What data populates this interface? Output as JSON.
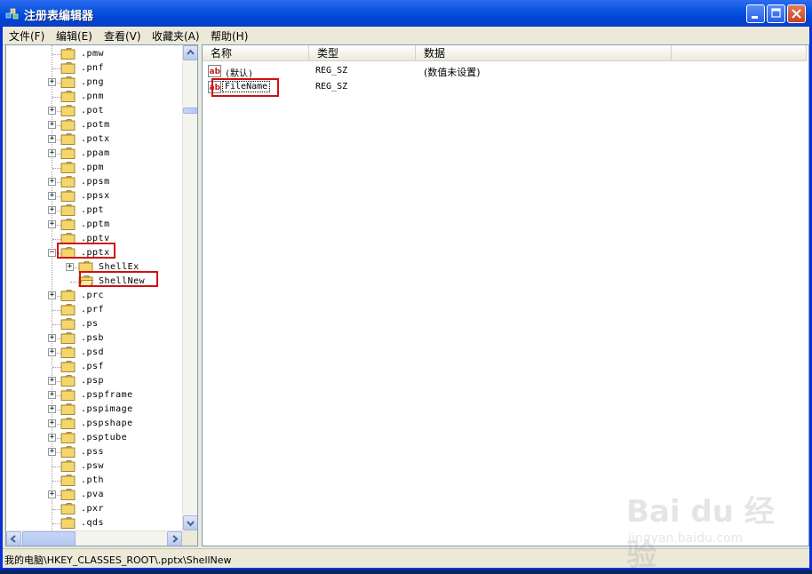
{
  "window": {
    "title": "注册表编辑器"
  },
  "menu": [
    {
      "label": "文件(F)"
    },
    {
      "label": "编辑(E)"
    },
    {
      "label": "查看(V)"
    },
    {
      "label": "收藏夹(A)"
    },
    {
      "label": "帮助(H)"
    }
  ],
  "tree": {
    "items": [
      {
        "label": ".pmw",
        "expandable": false
      },
      {
        "label": ".pnf",
        "expandable": false
      },
      {
        "label": ".png",
        "expandable": true
      },
      {
        "label": ".pnm",
        "expandable": false
      },
      {
        "label": ".pot",
        "expandable": true
      },
      {
        "label": ".potm",
        "expandable": true
      },
      {
        "label": ".potx",
        "expandable": true
      },
      {
        "label": ".ppam",
        "expandable": true
      },
      {
        "label": ".ppm",
        "expandable": false
      },
      {
        "label": ".ppsm",
        "expandable": true
      },
      {
        "label": ".ppsx",
        "expandable": true
      },
      {
        "label": ".ppt",
        "expandable": true
      },
      {
        "label": ".pptm",
        "expandable": true
      },
      {
        "label": ".pptv",
        "expandable": false
      },
      {
        "label": ".pptx",
        "expandable": true,
        "expanded": true,
        "highlighted": true
      },
      {
        "label": "ShellEx",
        "expandable": true,
        "child": true
      },
      {
        "label": "ShellNew",
        "expandable": false,
        "child": true,
        "open": true,
        "highlighted": true
      },
      {
        "label": ".prc",
        "expandable": true
      },
      {
        "label": ".prf",
        "expandable": false
      },
      {
        "label": ".ps",
        "expandable": false
      },
      {
        "label": ".psb",
        "expandable": true
      },
      {
        "label": ".psd",
        "expandable": true
      },
      {
        "label": ".psf",
        "expandable": false
      },
      {
        "label": ".psp",
        "expandable": true
      },
      {
        "label": ".pspframe",
        "expandable": true
      },
      {
        "label": ".pspimage",
        "expandable": true
      },
      {
        "label": ".pspshape",
        "expandable": true
      },
      {
        "label": ".psptube",
        "expandable": true
      },
      {
        "label": ".pss",
        "expandable": true
      },
      {
        "label": ".psw",
        "expandable": false
      },
      {
        "label": ".pth",
        "expandable": false
      },
      {
        "label": ".pva",
        "expandable": true
      },
      {
        "label": ".pxr",
        "expandable": false
      },
      {
        "label": ".qds",
        "expandable": false
      }
    ]
  },
  "list": {
    "columns": {
      "name": "名称",
      "type": "类型",
      "data": "数据"
    },
    "rows": [
      {
        "name": "(默认)",
        "type": "REG_SZ",
        "data": "(数值未设置)"
      },
      {
        "name": "FileName",
        "type": "REG_SZ",
        "data": "",
        "highlighted": true
      }
    ]
  },
  "status": {
    "path": "我的电脑\\HKEY_CLASSES_ROOT\\.pptx\\ShellNew"
  },
  "watermark": {
    "brand": "Bai du 经验",
    "url": "jingyan.baidu.com"
  },
  "colors": {
    "titlebar": "#0054e3",
    "highlight_box": "#d01010",
    "folder": "#f5d66b"
  }
}
